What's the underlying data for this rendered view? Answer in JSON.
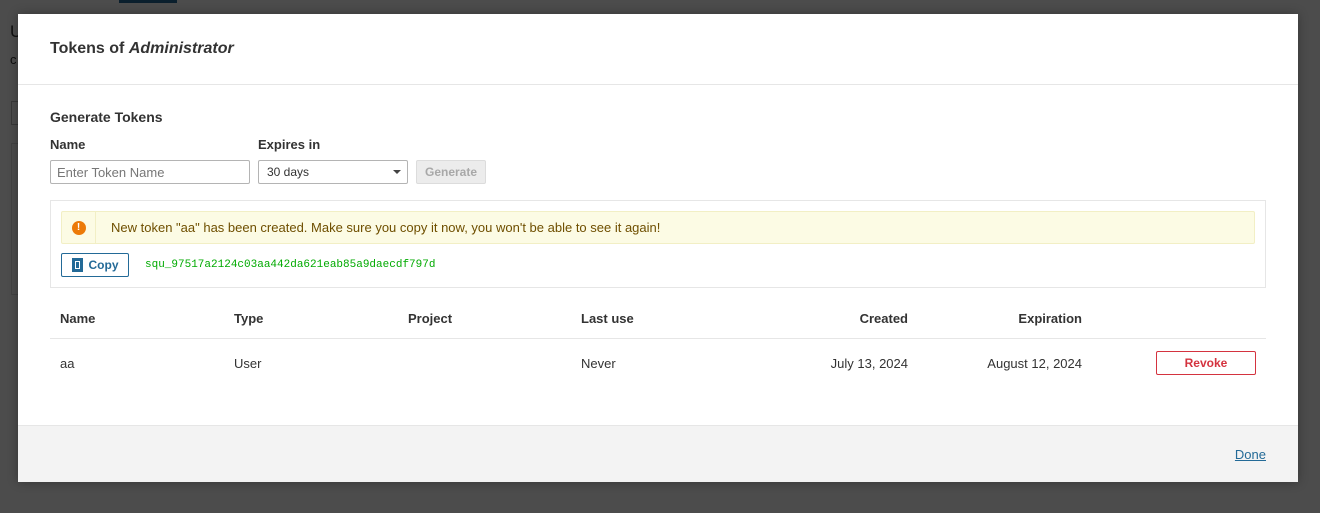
{
  "modal": {
    "title_prefix": "Tokens of",
    "title_user": "Administrator"
  },
  "generate": {
    "section_title": "Generate Tokens",
    "name_label": "Name",
    "name_placeholder": "Enter Token Name",
    "name_value": "",
    "expires_label": "Expires in",
    "expires_value": "30 days",
    "generate_label": "Generate"
  },
  "new_token": {
    "message": "New token \"aa\" has been created. Make sure you copy it now, you won't be able to see it again!",
    "copy_label": "Copy",
    "token": "squ_97517a2124c03aa442da621eab85a9daecdf797d"
  },
  "table": {
    "headers": {
      "name": "Name",
      "type": "Type",
      "project": "Project",
      "last_use": "Last use",
      "created": "Created",
      "expiration": "Expiration"
    },
    "rows": [
      {
        "name": "aa",
        "type": "User",
        "project": "",
        "last_use": "Never",
        "created": "July 13, 2024",
        "expiration": "August 12, 2024",
        "action": "Revoke"
      }
    ]
  },
  "footer": {
    "done_label": "Done"
  },
  "background": {
    "letter_1": "U",
    "letter_2": "c"
  },
  "colors": {
    "accent": "#236a97",
    "warning": "#ec7a08",
    "danger": "#d4333f",
    "token_text": "#00aa00"
  }
}
